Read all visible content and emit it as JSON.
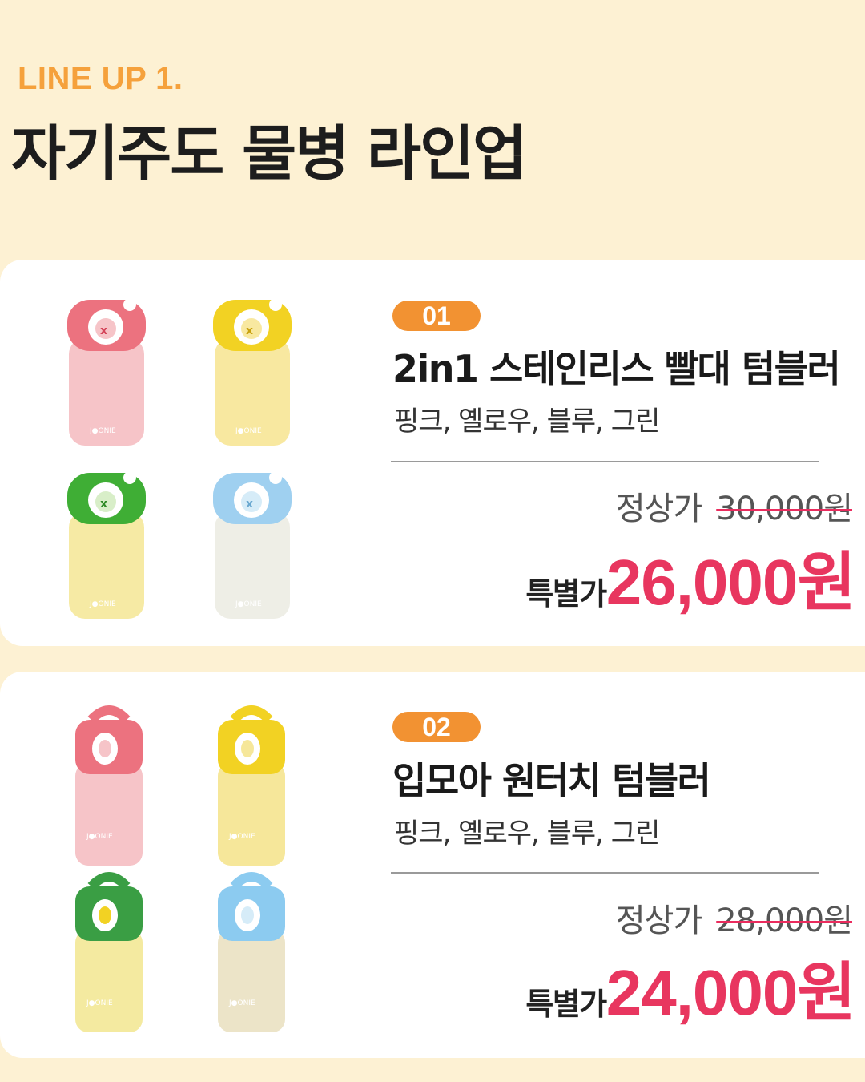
{
  "header": {
    "eyebrow": "LINE UP 1.",
    "title": "자기주도 물병 라인업"
  },
  "colors": {
    "accent_orange": "#f29232",
    "price_pink": "#e8365f",
    "background": "#fdf1d3"
  },
  "products": [
    {
      "number": "01",
      "name": "2in1 스테인리스 빨대 텀블러",
      "options": "핑크, 옐로우, 블루, 그린",
      "regular_label": "정상가",
      "regular_price": "30,000원",
      "special_label": "특별가",
      "special_price": "26,000원",
      "image_icons": [
        "straw-tumbler-pink",
        "straw-tumbler-yellow",
        "straw-tumbler-green",
        "straw-tumbler-blue"
      ]
    },
    {
      "number": "02",
      "name": "입모아 원터치 텀블러",
      "options": "핑크, 옐로우, 블루, 그린",
      "regular_label": "정상가",
      "regular_price": "28,000원",
      "special_label": "특별가",
      "special_price": "24,000원",
      "image_icons": [
        "one-touch-tumbler-pink",
        "one-touch-tumbler-yellow",
        "one-touch-tumbler-green",
        "one-touch-tumbler-blue"
      ]
    }
  ]
}
